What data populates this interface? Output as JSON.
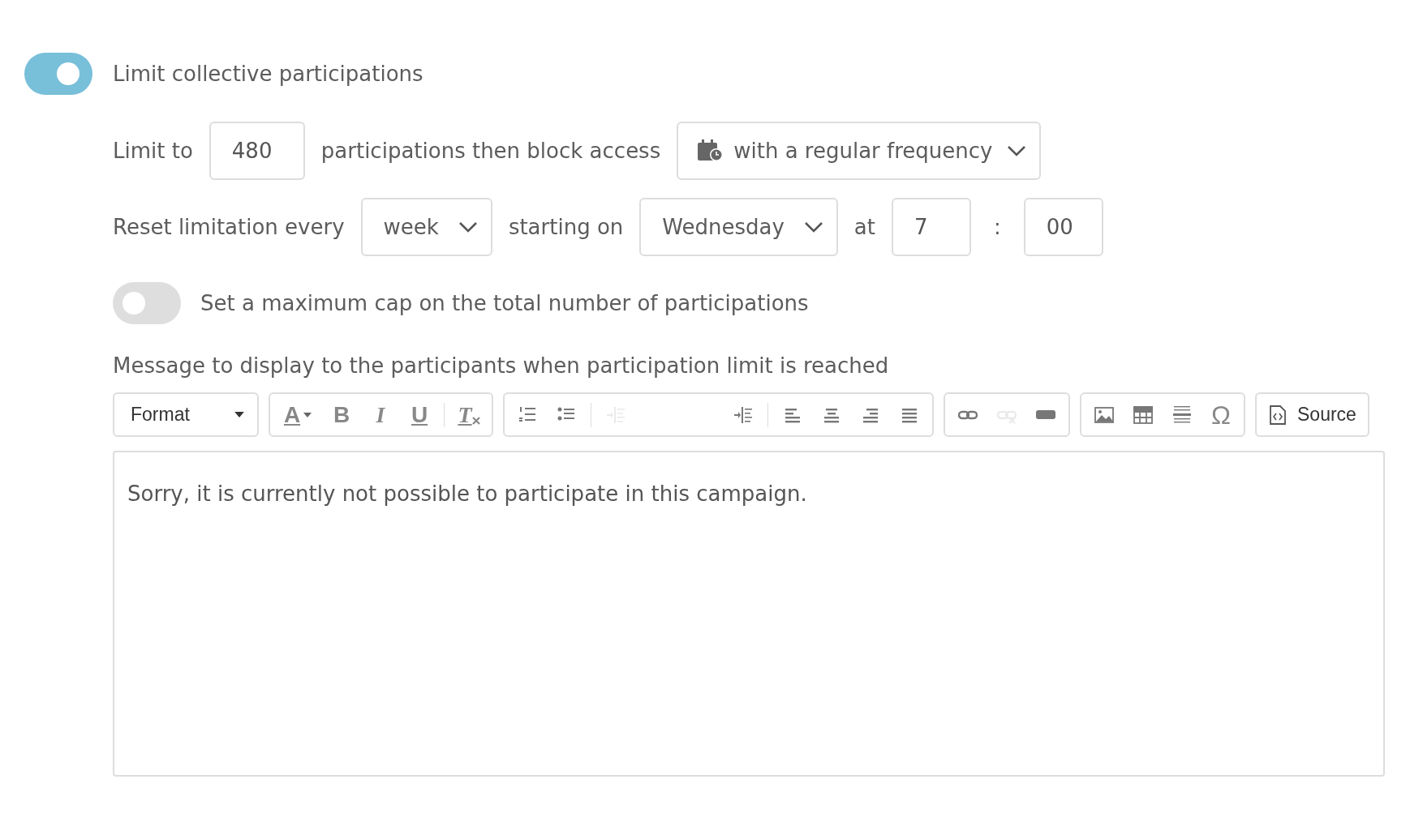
{
  "limit_toggle": {
    "label": "Limit collective participations",
    "on": true
  },
  "limit_row": {
    "prefix": "Limit to",
    "count": "480",
    "middle": "participations then block access",
    "mode": "with a regular frequency"
  },
  "reset_row": {
    "prefix": "Reset limitation every",
    "period": "week",
    "starting": "starting on",
    "day": "Wednesday",
    "at": "at",
    "hour": "7",
    "colon": ":",
    "minute": "00"
  },
  "cap_toggle": {
    "label": "Set a maximum cap on the total number of participations",
    "on": false
  },
  "message_label": "Message to display to the participants when participation limit is reached",
  "toolbar": {
    "groups": [
      {
        "items": [
          {
            "kind": "format",
            "label": "Format",
            "disabled": false
          }
        ]
      },
      {
        "items": [
          {
            "kind": "text-color",
            "label": "A",
            "disabled": false
          },
          {
            "kind": "bold",
            "label": "B",
            "disabled": false
          },
          {
            "kind": "italic",
            "label": "I",
            "disabled": false
          },
          {
            "kind": "underline",
            "label": "U",
            "disabled": false
          },
          {
            "kind": "separator"
          },
          {
            "kind": "remove-format",
            "label": "T",
            "disabled": false
          }
        ]
      },
      {
        "items": [
          {
            "kind": "numbered-list",
            "disabled": false
          },
          {
            "kind": "bulleted-list",
            "disabled": false
          },
          {
            "kind": "separator"
          },
          {
            "kind": "outdent",
            "disabled": true
          },
          {
            "kind": "indent",
            "disabled": false
          },
          {
            "kind": "separator"
          },
          {
            "kind": "align-left",
            "disabled": false
          },
          {
            "kind": "align-center",
            "disabled": false
          },
          {
            "kind": "align-right",
            "disabled": false
          },
          {
            "kind": "justify",
            "disabled": false
          }
        ]
      },
      {
        "items": [
          {
            "kind": "link",
            "disabled": false
          },
          {
            "kind": "unlink",
            "disabled": true
          },
          {
            "kind": "placeholder",
            "disabled": false
          }
        ]
      },
      {
        "items": [
          {
            "kind": "image",
            "disabled": false
          },
          {
            "kind": "table",
            "disabled": false
          },
          {
            "kind": "horizontal-line",
            "disabled": false
          },
          {
            "kind": "special-char",
            "label": "Ω",
            "disabled": false
          }
        ]
      },
      {
        "items": [
          {
            "kind": "source",
            "label": "Source",
            "disabled": false
          }
        ]
      }
    ]
  },
  "editor": {
    "value": "Sorry, it is currently not possible to participate in this campaign."
  }
}
